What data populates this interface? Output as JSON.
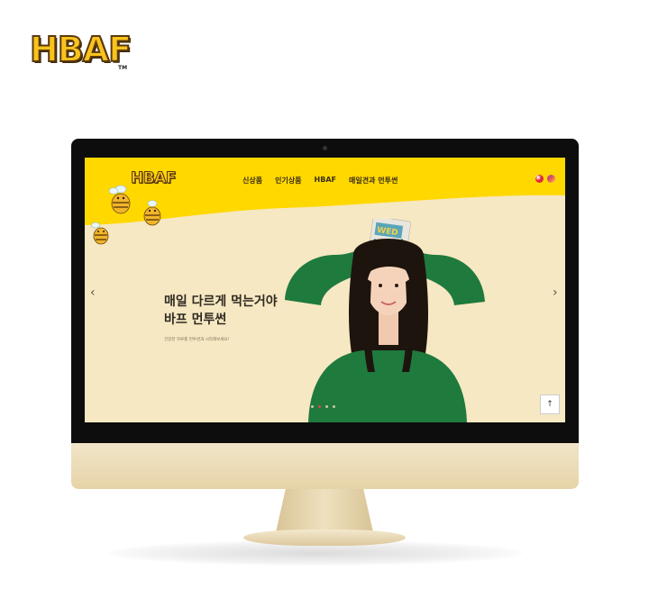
{
  "brand": {
    "logo_text": "HBAF",
    "trademark": "TM"
  },
  "site": {
    "logo_text": "HBAF",
    "nav": [
      {
        "label": "신상품"
      },
      {
        "label": "인기상품"
      },
      {
        "label": "HBAF"
      },
      {
        "label": "매일견과 먼투썬"
      }
    ],
    "social": [
      {
        "icon": "youtube-icon"
      },
      {
        "icon": "instagram-icon"
      }
    ]
  },
  "hero": {
    "headline_line1": "매일 다르게 먹는거야",
    "headline_line2": "바프 먼투썬",
    "subtext": "건강한 하루를 먼투썬과 시작해보세요!",
    "product_label": "WED",
    "slides": {
      "count": 4,
      "active": 2
    },
    "prev_glyph": "‹",
    "next_glyph": "›",
    "top_glyph": "↑"
  },
  "colors": {
    "header_yellow": "#ffd800",
    "background_cream": "#f6e8c2",
    "logo_gold": "#f7c01a",
    "dot_active": "#e2454a"
  }
}
